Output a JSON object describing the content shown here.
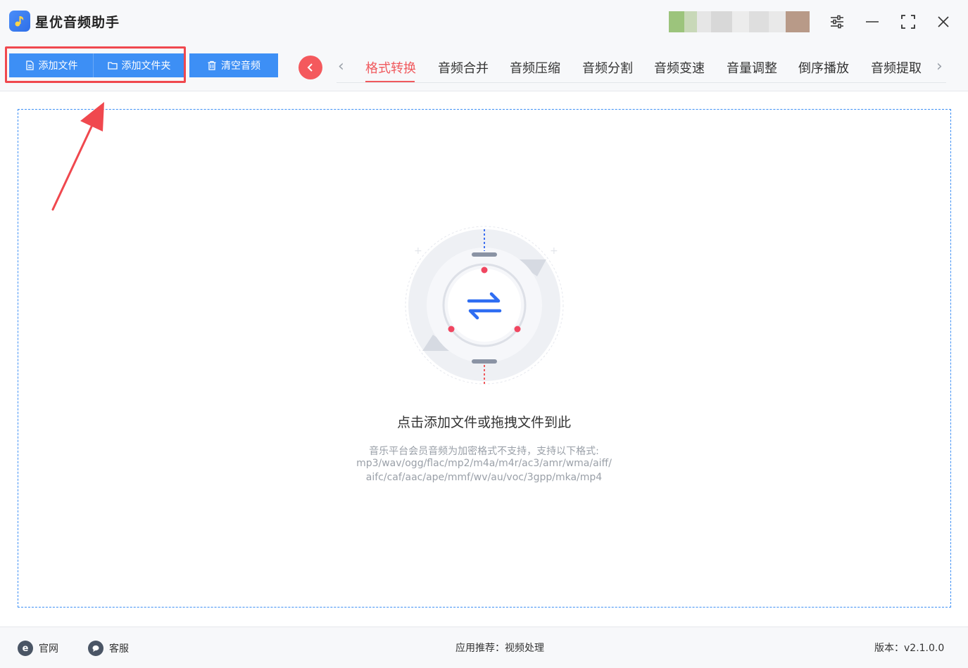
{
  "app": {
    "title": "星优音频助手"
  },
  "toolbar": {
    "add_file": "添加文件",
    "add_folder": "添加文件夹",
    "clear_audio": "清空音频"
  },
  "tabs": [
    {
      "label": "格式转换",
      "active": true
    },
    {
      "label": "音频合并"
    },
    {
      "label": "音频压缩"
    },
    {
      "label": "音频分割"
    },
    {
      "label": "音频变速"
    },
    {
      "label": "音量调整"
    },
    {
      "label": "倒序播放"
    },
    {
      "label": "音频提取"
    }
  ],
  "dropzone": {
    "title": "点击添加文件或拖拽文件到此",
    "note_line1": "音乐平台会员音频为加密格式不支持，支持以下格式:",
    "note_line2": "mp3/wav/ogg/flac/mp2/m4a/m4r/ac3/amr/wma/aiff/",
    "note_line3": "aifc/caf/aac/ape/mmf/wv/au/voc/3gpp/mka/mp4"
  },
  "footer": {
    "website": "官网",
    "support": "客服",
    "recommend_label": "应用推荐：",
    "recommend_value": "视频处理",
    "version": "版本：v2.1.0.0"
  },
  "icons": {
    "website_icon": "e",
    "support_icon": "chat"
  },
  "colors": {
    "accent_blue": "#3d8ff5",
    "accent_red": "#f0595d",
    "highlight_red": "#f0484e"
  }
}
